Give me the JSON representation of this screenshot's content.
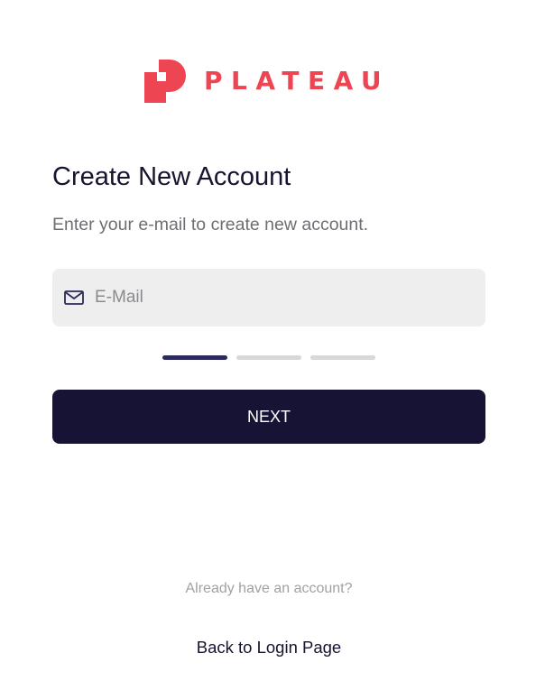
{
  "brand": {
    "name": "PLATEAU",
    "color": "#ee4553",
    "logo_icon": "plateau-logo-mark"
  },
  "form": {
    "title": "Create New Account",
    "subtitle": "Enter your e-mail to create new account.",
    "email": {
      "icon": "mail-icon",
      "placeholder": "E-Mail",
      "value": ""
    },
    "progress": {
      "total_steps": 3,
      "current_step": 1,
      "active_color": "#2b2a5c",
      "inactive_color": "#d8d8d8"
    },
    "next_label": "NEXT",
    "button_color": "#161334"
  },
  "footer": {
    "prompt": "Already have an account?",
    "login_link": "Back to Login Page"
  }
}
